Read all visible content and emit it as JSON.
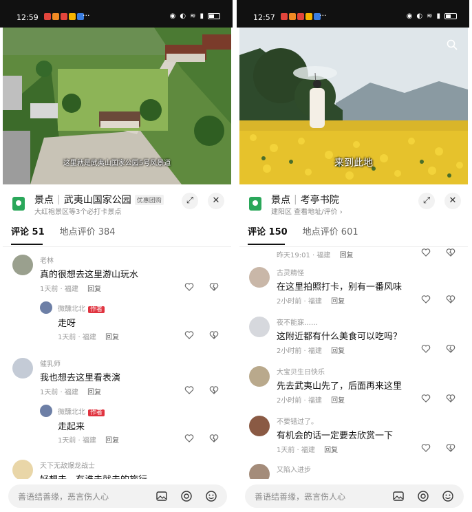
{
  "left": {
    "status": {
      "time": "12:59",
      "dots": "···"
    },
    "video": {
      "caption": "这里就是武夷山国家公园5号风景道"
    },
    "place": {
      "type": "景点",
      "name": "武夷山国家公园",
      "coupon": "优惠团购",
      "subtitle": "大红袍景区等3个必打卡景点"
    },
    "tabs": [
      {
        "label": "评论 51"
      },
      {
        "label": "地点评价 384"
      }
    ],
    "comments": [
      {
        "name": "老林",
        "text": "真的很想去这里游山玩水",
        "time": "1天前",
        "loc": "福建",
        "reply": "回复"
      },
      {
        "name": "微醺北北",
        "badge": "作者",
        "text": "走呀",
        "time": "1天前",
        "loc": "福建",
        "reply": "回复"
      },
      {
        "name": "催乳师",
        "text": "我也想去这里看表演",
        "time": "1天前",
        "loc": "福建",
        "reply": "回复"
      },
      {
        "name": "微醺北北",
        "badge": "作者",
        "text": "走起来",
        "time": "1天前",
        "loc": "福建",
        "reply": "回复"
      },
      {
        "name": "天下无敌爆龙战士",
        "text": "好想去，有谁去就去的旅行"
      }
    ],
    "input": {
      "placeholder": "善语结善缘，恶言伤人心"
    }
  },
  "right": {
    "status": {
      "time": "12:57",
      "dots": "···"
    },
    "video": {
      "caption": "来到此地"
    },
    "place": {
      "type": "景点",
      "name": "考亭书院",
      "subtitle": "建阳区  查看地址/评价 ›"
    },
    "tabs": [
      {
        "label": "评论 150"
      },
      {
        "label": "地点评价 601"
      }
    ],
    "top_meta": {
      "time": "昨天19:01",
      "loc": "福建",
      "reply": "回复"
    },
    "comments": [
      {
        "name": "古灵精怪",
        "text": "在这里拍照打卡，别有一番风味",
        "time": "2小时前",
        "loc": "福建",
        "reply": "回复"
      },
      {
        "name": "夜不能寐……",
        "text": "这附近都有什么美食可以吃吗？",
        "time": "2小时前",
        "loc": "福建",
        "reply": "回复"
      },
      {
        "name": "大宝贝生日快乐",
        "text": "先去武夷山先了，后面再来这里",
        "time": "2小时前",
        "loc": "福建",
        "reply": "回复"
      },
      {
        "name": "不要错过了。",
        "text": "有机会的话一定要去欣赏一下",
        "time": "1天前",
        "loc": "福建",
        "reply": "回复"
      },
      {
        "name": "又陷入进步"
      }
    ],
    "input": {
      "placeholder": "善语结善缘，恶言伤人心"
    }
  },
  "colors": {
    "accent_green": "#2aa75a",
    "author_badge": "#e0333f"
  },
  "icons": [
    "location-icon",
    "share-icon",
    "close-icon",
    "heart-icon",
    "dislike-icon",
    "image-icon",
    "at-icon",
    "emoji-icon",
    "search-icon"
  ]
}
